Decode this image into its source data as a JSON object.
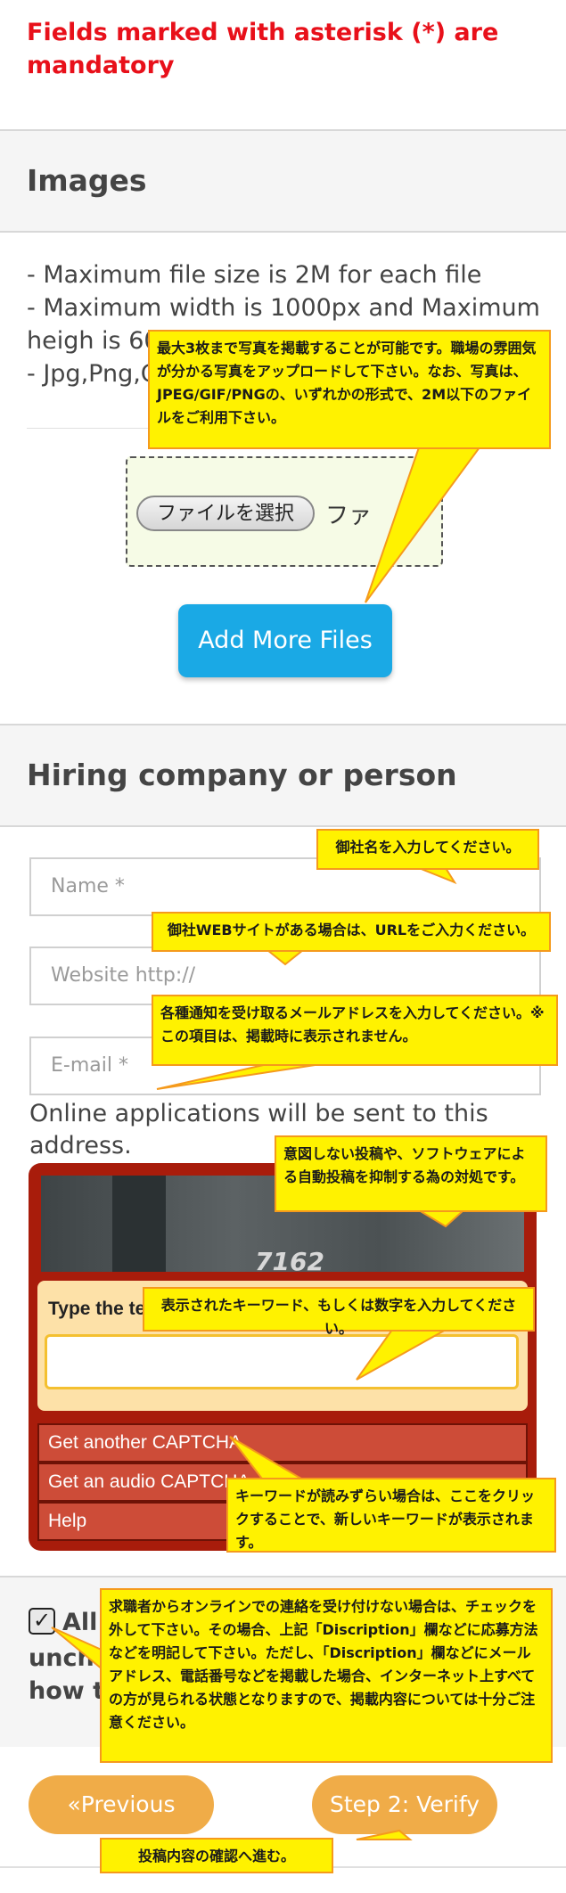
{
  "mandatory_note": "Fields marked with asterisk (*) are mandatory",
  "images_section": {
    "title": "Images",
    "rules": [
      "- Maximum file size is 2M for each file",
      "- Maximum width is 1000px and Maximum",
      "heigh is 60",
      "- Jpg,Png,G"
    ],
    "file_button": "ファイルを選択",
    "file_status": "ファ",
    "add_more": "Add More Files"
  },
  "hiring_section": {
    "title": "Hiring company or person",
    "name_placeholder": "Name *",
    "website_placeholder": "Website http://",
    "email_placeholder": "E-mail *",
    "applications_note": "Online applications will be sent to this address."
  },
  "captcha": {
    "image_text": "7162",
    "label": "Type the te",
    "links": [
      "Get another CAPTCHA",
      "Get an audio CAPTCHA",
      "Help"
    ]
  },
  "allow_online": {
    "checked": true,
    "line1": "All",
    "line2": "unch",
    "line3": "how t"
  },
  "nav": {
    "previous": "«Previous",
    "next": "Step 2: Verify"
  },
  "callouts": {
    "images": "最大3枚まで写真を掲載することが可能です。職場の雰囲気が分かる写真をアップロードして下さい。なお、写真は、JPEG/GIF/PNGの、いずれかの形式で、2M以下のファイルをご利用下さい。",
    "name": "御社名を入力してください。",
    "website": "御社WEBサイトがある場合は、URLをご入力ください。",
    "email": "各種通知を受け取るメールアドレスを入力してください。※この項目は、掲載時に表示されません。",
    "captcha_purpose": "意図しない投稿や、ソフトウェアによる自動投稿を抑制する為の対処です。",
    "captcha_input": "表示されたキーワード、もしくは数字を入力してください。",
    "captcha_refresh": "キーワードが読みずらい場合は、ここをクリックすることで、新しいキーワードが表示されます。",
    "allow_online": "求職者からオンラインでの連絡を受け付けない場合は、チェックを外して下さい。その場合、上記「Discription」欄などに応募方法などを明記して下さい。ただし、「Discription」欄などにメールアドレス、電話番号などを掲載した場合、インターネット上すべての方が見られる状態となりますので、掲載内容については十分ご注意ください。",
    "verify": "投稿内容の確認へ進む。"
  }
}
